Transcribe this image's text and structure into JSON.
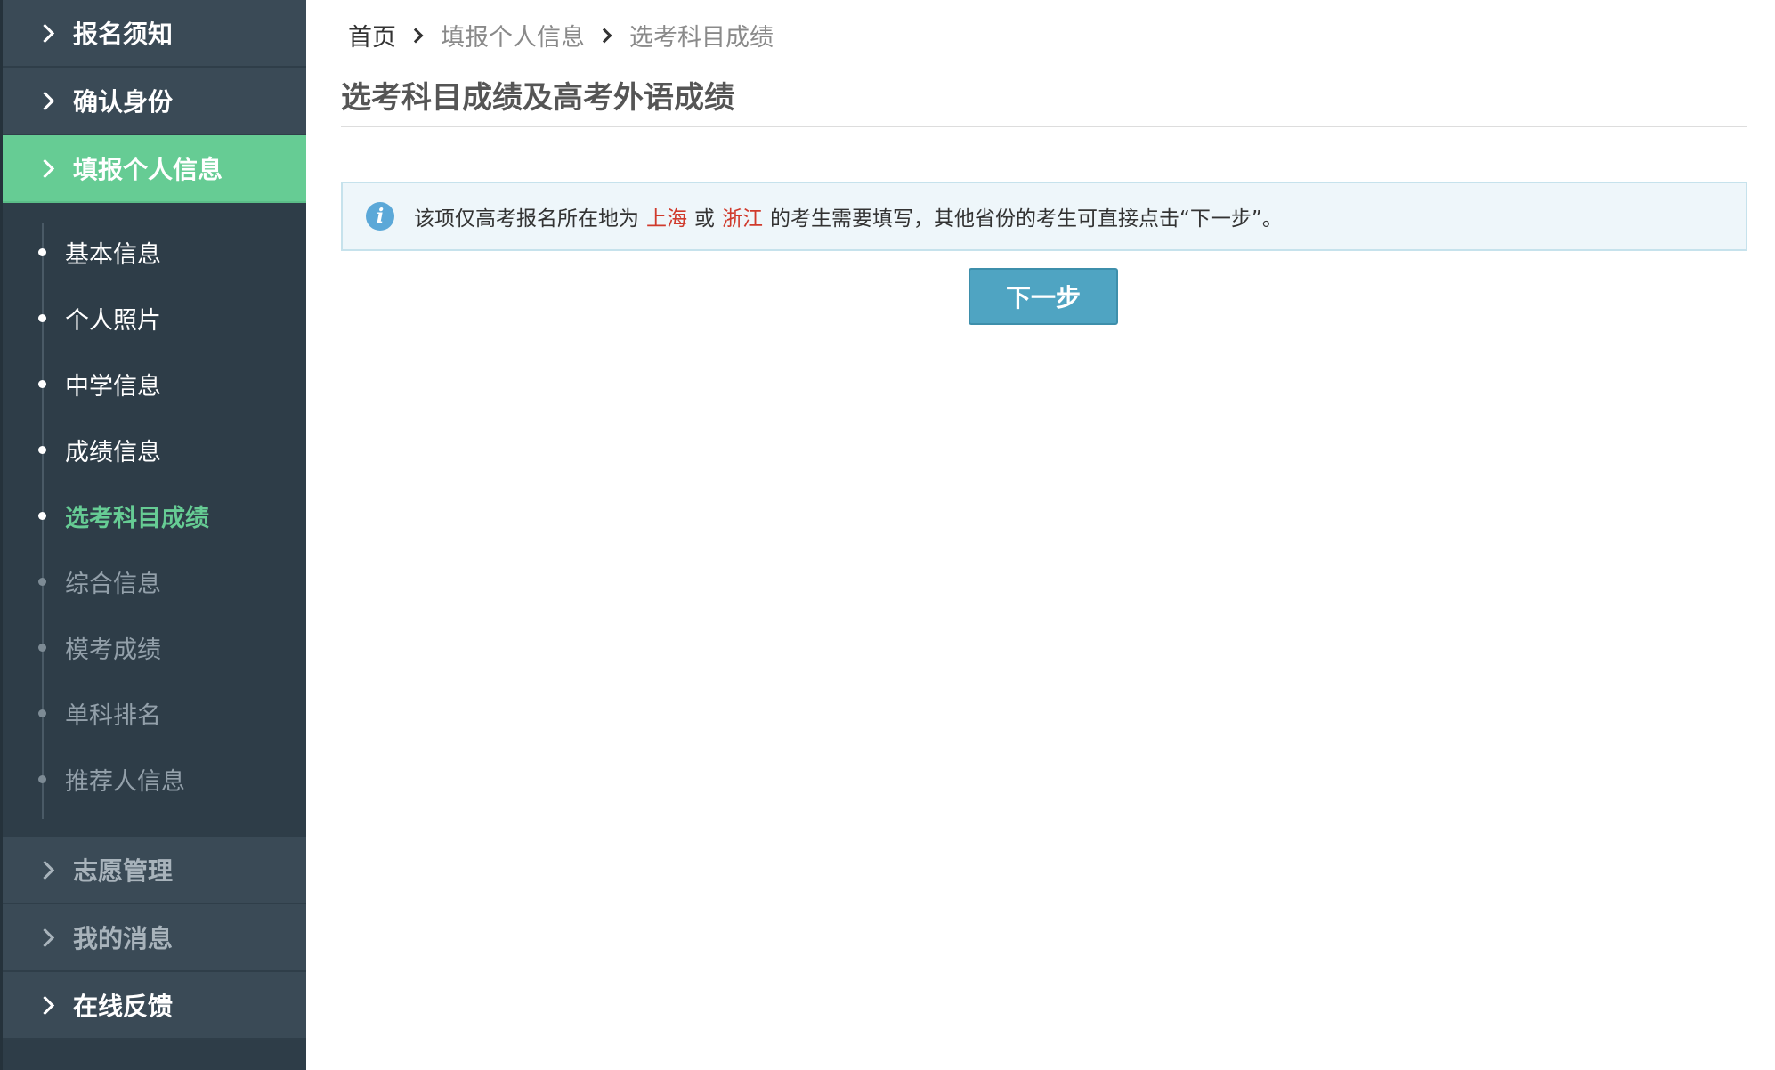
{
  "sidebar": {
    "top_items": [
      {
        "label": "报名须知"
      },
      {
        "label": "确认身份"
      },
      {
        "label": "填报个人信息"
      }
    ],
    "sub_items": [
      {
        "label": "基本信息"
      },
      {
        "label": "个人照片"
      },
      {
        "label": "中学信息"
      },
      {
        "label": "成绩信息"
      },
      {
        "label": "选考科目成绩"
      },
      {
        "label": "综合信息"
      },
      {
        "label": "模考成绩"
      },
      {
        "label": "单科排名"
      },
      {
        "label": "推荐人信息"
      }
    ],
    "bottom_items": [
      {
        "label": "志愿管理"
      },
      {
        "label": "我的消息"
      },
      {
        "label": "在线反馈"
      }
    ]
  },
  "breadcrumb": {
    "home": "首页",
    "level1": "填报个人信息",
    "level2": "选考科目成绩"
  },
  "main": {
    "title": "选考科目成绩及高考外语成绩",
    "notice": {
      "part1": "该项仅高考报名所在地为",
      "place1": "上海",
      "part2": "或",
      "place2": "浙江",
      "part3": "的考生需要填写，其他省份的考生可直接点击“下一步”。"
    },
    "next_button": "下一步"
  },
  "colors": {
    "sidebar_bg": "#2e3d48",
    "active_green": "#66cc94",
    "button_blue": "#4fa4c2",
    "highlight_red": "#d03a2c",
    "info_bg": "#eef6fa"
  },
  "icons": {
    "notice": "info-icon",
    "nav": "chevron-right-icon"
  }
}
